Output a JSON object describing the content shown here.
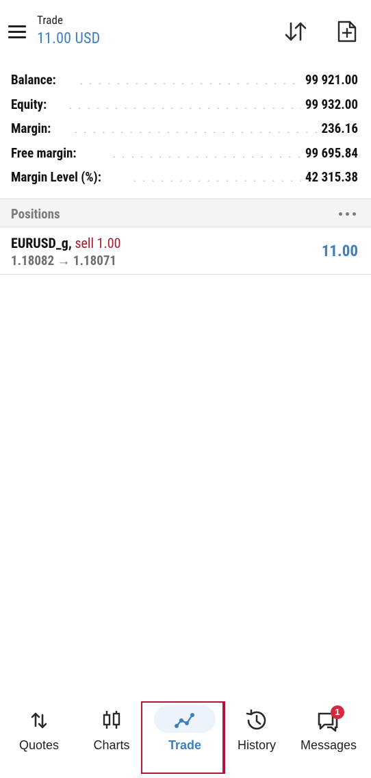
{
  "header": {
    "title": "Trade",
    "subtitle": "11.00 USD",
    "icons": [
      "menu-icon",
      "sort-icon",
      "new-order-icon"
    ]
  },
  "summary": {
    "rows": [
      {
        "label": "Balance:",
        "value": "99 921.00"
      },
      {
        "label": "Equity:",
        "value": "99 932.00"
      },
      {
        "label": "Margin:",
        "value": "236.16"
      },
      {
        "label": "Free margin:",
        "value": "99 695.84"
      },
      {
        "label": "Margin Level (%):",
        "value": "42 315.38"
      }
    ]
  },
  "positions": {
    "title": "Positions",
    "items": [
      {
        "symbol": "EURUSD_g,",
        "side": "sell 1.00",
        "prices": "1.18082 → 1.18071",
        "profit": "11.00"
      }
    ]
  },
  "nav": {
    "items": [
      {
        "label": "Quotes",
        "icon": "quotes-icon"
      },
      {
        "label": "Charts",
        "icon": "candlestick-icon"
      },
      {
        "label": "Trade",
        "icon": "trade-icon",
        "active": true
      },
      {
        "label": "History",
        "icon": "history-icon"
      },
      {
        "label": "Messages",
        "icon": "messages-icon",
        "badge": "1"
      }
    ]
  },
  "colors": {
    "accent": "#3f7fbf",
    "sell": "#a51c2e",
    "highlight": "#b3123b",
    "badge": "#d7263d"
  }
}
